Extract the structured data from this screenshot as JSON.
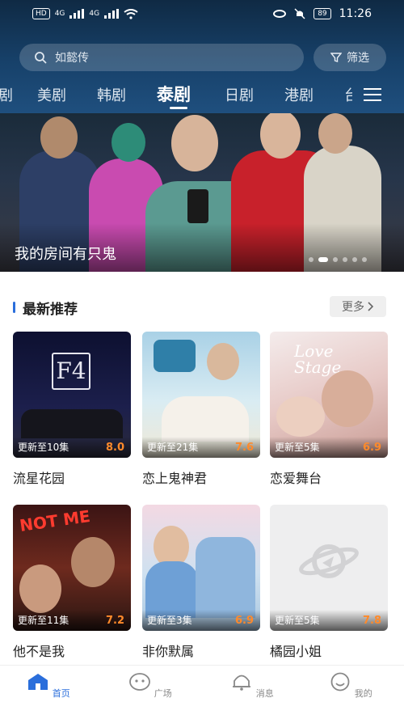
{
  "status_bar": {
    "left_chip": "HD",
    "signal_label_1": "4G",
    "signal_label_2": "4G",
    "battery": "89",
    "time": "11:26"
  },
  "search": {
    "placeholder": "如懿传"
  },
  "filter": {
    "label": "筛选"
  },
  "tabs": [
    {
      "label": "剧"
    },
    {
      "label": "美剧"
    },
    {
      "label": "韩剧"
    },
    {
      "label": "泰剧"
    },
    {
      "label": "日剧"
    },
    {
      "label": "港剧"
    },
    {
      "label": "台"
    }
  ],
  "active_tab": "泰剧",
  "banner": {
    "title": "我的房间有只鬼",
    "dot_count": 6,
    "active_dot": 2
  },
  "section": {
    "title": "最新推荐",
    "more_label": "更多"
  },
  "items": [
    {
      "title": "流星花园",
      "episode": "更新至10集",
      "score": "8.0"
    },
    {
      "title": "恋上鬼神君",
      "episode": "更新至21集",
      "score": "7.6"
    },
    {
      "title": "恋爱舞台",
      "episode": "更新至5集",
      "score": "6.9"
    },
    {
      "title": "他不是我",
      "episode": "更新至11集",
      "score": "7.2"
    },
    {
      "title": "非你默属",
      "episode": "更新至3集",
      "score": "6.9"
    },
    {
      "title": "橘园小姐",
      "episode": "更新至5集",
      "score": "7.8"
    }
  ],
  "nav": [
    {
      "label": "首页",
      "icon": "home-icon"
    },
    {
      "label": "广场",
      "icon": "plaza-icon"
    },
    {
      "label": "消息",
      "icon": "bell-icon"
    },
    {
      "label": "我的",
      "icon": "profile-icon"
    }
  ],
  "colors": {
    "accent": "#2a6edb",
    "score": "#ff8a2b",
    "header": "#17416a"
  }
}
